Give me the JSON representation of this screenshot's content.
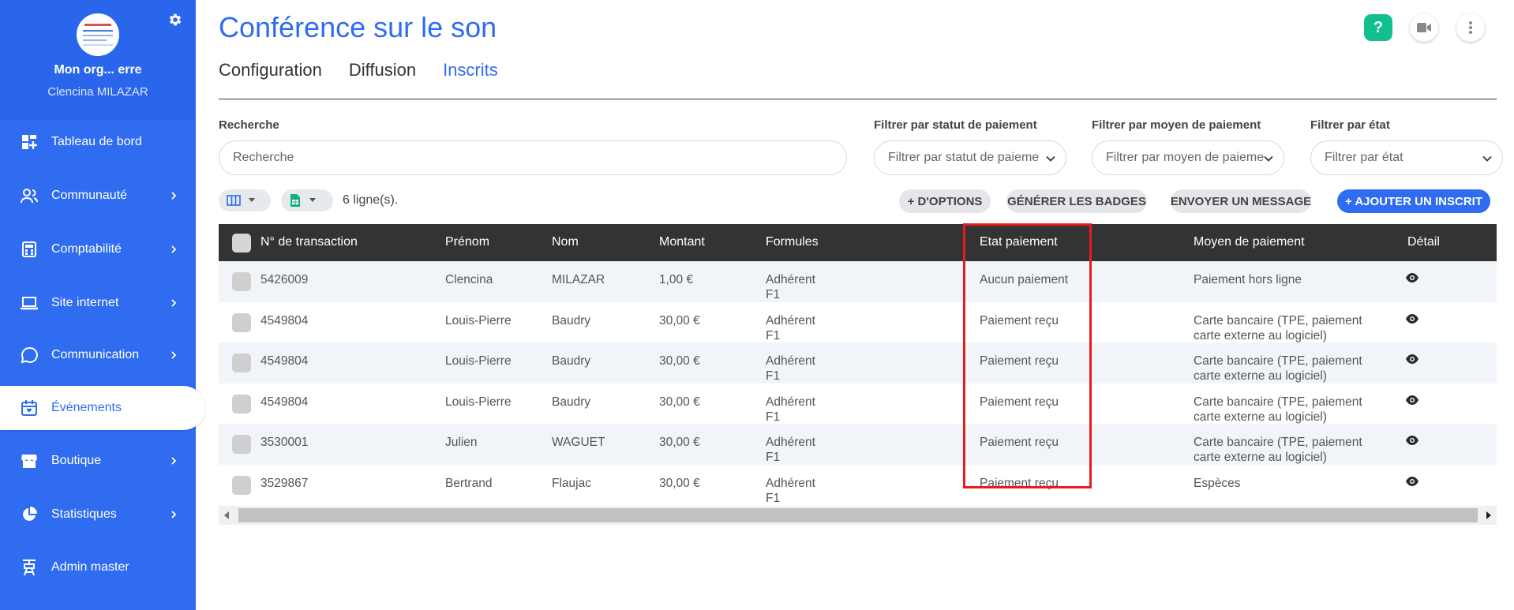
{
  "colors": {
    "primary": "#2f6cf0",
    "help": "#12c08e",
    "header_bg": "#333333",
    "highlight": "#e81c1c"
  },
  "sidebar": {
    "org_name": "Mon org... erre",
    "user_name": "Clencina MILAZAR",
    "items": [
      {
        "label": "Tableau de bord",
        "icon": "dashboard-icon",
        "has_chevron": false
      },
      {
        "label": "Communauté",
        "icon": "community-icon",
        "has_chevron": true
      },
      {
        "label": "Comptabilité",
        "icon": "calculator-icon",
        "has_chevron": true
      },
      {
        "label": "Site internet",
        "icon": "laptop-icon",
        "has_chevron": true
      },
      {
        "label": "Communication",
        "icon": "chat-icon",
        "has_chevron": true
      },
      {
        "label": "Événements",
        "icon": "calendar-icon",
        "has_chevron": false,
        "active": true
      },
      {
        "label": "Boutique",
        "icon": "store-icon",
        "has_chevron": true
      },
      {
        "label": "Statistiques",
        "icon": "pie-chart-icon",
        "has_chevron": true
      },
      {
        "label": "Admin master",
        "icon": "admin-icon",
        "has_chevron": false
      }
    ]
  },
  "header": {
    "title": "Conférence sur le son",
    "tabs": [
      "Configuration",
      "Diffusion",
      "Inscrits"
    ],
    "active_tab": "Inscrits",
    "help_label": "?"
  },
  "filters": {
    "search_label": "Recherche",
    "search_placeholder": "Recherche",
    "status_label": "Filtrer par statut de paiement",
    "status_placeholder": "Filtrer par statut de paieme",
    "method_label": "Filtrer par moyen de paiement",
    "method_placeholder": "Filtrer par moyen de paieme",
    "state_label": "Filtrer par état",
    "state_placeholder": "Filtrer par état"
  },
  "toolbar": {
    "rows_count": "6 ligne(s).",
    "more_options": "+ D'OPTIONS",
    "generate_badges": "GÉNÉRER LES BADGES",
    "send_message": "ENVOYER UN MESSAGE",
    "add_registrant": "+ AJOUTER UN INSCRIT"
  },
  "table": {
    "columns": [
      "N° de transaction",
      "Prénom",
      "Nom",
      "Montant",
      "Formules",
      "Etat paiement",
      "Moyen de paiement",
      "Détail"
    ],
    "rows": [
      {
        "transaction": "5426009",
        "prenom": "Clencina",
        "nom": "MILAZAR",
        "montant": "1,00 €",
        "formule_1": "Adhérent",
        "formule_2": "F1",
        "etat": "Aucun paiement",
        "moyen_1": "Paiement hors ligne",
        "moyen_2": ""
      },
      {
        "transaction": "4549804",
        "prenom": "Louis-Pierre",
        "nom": "Baudry",
        "montant": "30,00 €",
        "formule_1": "Adhérent",
        "formule_2": "F1",
        "etat": "Paiement reçu",
        "moyen_1": "Carte bancaire (TPE, paiement",
        "moyen_2": "carte externe au logiciel)"
      },
      {
        "transaction": "4549804",
        "prenom": "Louis-Pierre",
        "nom": "Baudry",
        "montant": "30,00 €",
        "formule_1": "Adhérent",
        "formule_2": "F1",
        "etat": "Paiement reçu",
        "moyen_1": "Carte bancaire (TPE, paiement",
        "moyen_2": "carte externe au logiciel)"
      },
      {
        "transaction": "4549804",
        "prenom": "Louis-Pierre",
        "nom": "Baudry",
        "montant": "30,00 €",
        "formule_1": "Adhérent",
        "formule_2": "F1",
        "etat": "Paiement reçu",
        "moyen_1": "Carte bancaire (TPE, paiement",
        "moyen_2": "carte externe au logiciel)"
      },
      {
        "transaction": "3530001",
        "prenom": "Julien",
        "nom": "WAGUET",
        "montant": "30,00 €",
        "formule_1": "Adhérent",
        "formule_2": "F1",
        "etat": "Paiement reçu",
        "moyen_1": "Carte bancaire (TPE, paiement",
        "moyen_2": "carte externe au logiciel)"
      },
      {
        "transaction": "3529867",
        "prenom": "Bertrand",
        "nom": "Flaujac",
        "montant": "30,00 €",
        "formule_1": "Adhérent",
        "formule_2": "F1",
        "etat": "Paiement reçu",
        "moyen_1": "Espèces",
        "moyen_2": ""
      }
    ]
  }
}
